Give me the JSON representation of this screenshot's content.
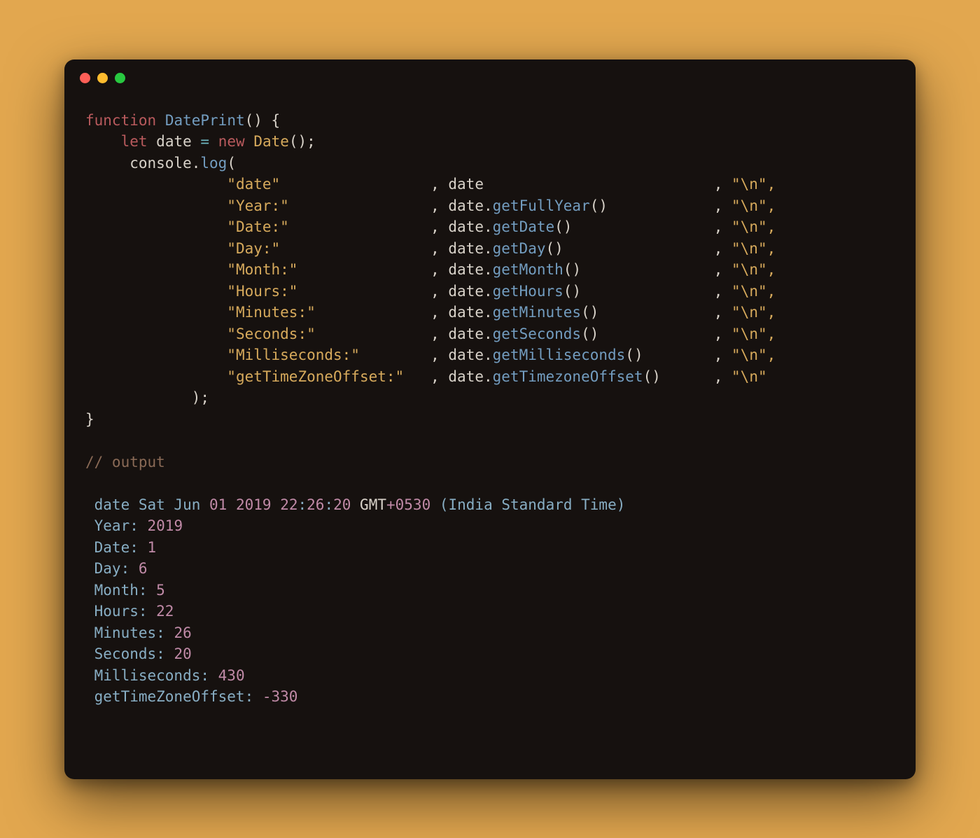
{
  "code": {
    "kw_function": "function",
    "fn_name": "DatePrint",
    "kw_let": "let",
    "var_date": "date",
    "op_eq": "=",
    "kw_new": "new",
    "cls_date": "Date",
    "obj_console": "console",
    "fn_log": "log",
    "rows": [
      {
        "label": "\"date\"",
        "expr_pre": "date",
        "expr_fn": "",
        "nl": "\"\\n\","
      },
      {
        "label": "\"Year:\"",
        "expr_pre": "date.",
        "expr_fn": "getFullYear",
        "nl": "\"\\n\","
      },
      {
        "label": "\"Date:\"",
        "expr_pre": "date.",
        "expr_fn": "getDate",
        "nl": "\"\\n\","
      },
      {
        "label": "\"Day:\"",
        "expr_pre": "date.",
        "expr_fn": "getDay",
        "nl": "\"\\n\","
      },
      {
        "label": "\"Month:\"",
        "expr_pre": "date.",
        "expr_fn": "getMonth",
        "nl": "\"\\n\","
      },
      {
        "label": "\"Hours:\"",
        "expr_pre": "date.",
        "expr_fn": "getHours",
        "nl": "\"\\n\","
      },
      {
        "label": "\"Minutes:\"",
        "expr_pre": "date.",
        "expr_fn": "getMinutes",
        "nl": "\"\\n\","
      },
      {
        "label": "\"Seconds:\"",
        "expr_pre": "date.",
        "expr_fn": "getSeconds",
        "nl": "\"\\n\","
      },
      {
        "label": "\"Milliseconds:\"",
        "expr_pre": "date.",
        "expr_fn": "getMilliseconds",
        "nl": "\"\\n\","
      },
      {
        "label": "\"getTimeZoneOffset:\"",
        "expr_pre": "date.",
        "expr_fn": "getTimezoneOffset",
        "nl": "\"\\n\""
      }
    ],
    "comment_out": "// output"
  },
  "output": {
    "line1": {
      "prefix": " date Sat Jun ",
      "d01": "01",
      "sp1": " ",
      "yr": "2019",
      "sp2": " ",
      "hh": "22",
      "c1": ":",
      "mm": "26",
      "c2": ":",
      "ss": "20",
      "gmt": " GMT",
      "plus": "+",
      "off": "0530",
      "tz": " (India Standard Time) "
    },
    "pairs": [
      {
        "k": " Year: ",
        "v": "2019"
      },
      {
        "k": " Date: ",
        "v": "1"
      },
      {
        "k": " Day: ",
        "v": "6"
      },
      {
        "k": " Month: ",
        "v": "5"
      },
      {
        "k": " Hours: ",
        "v": "22"
      },
      {
        "k": " Minutes: ",
        "v": "26"
      },
      {
        "k": " Seconds: ",
        "v": "20"
      },
      {
        "k": " Milliseconds: ",
        "v": "430"
      },
      {
        "k": " getTimeZoneOffset: ",
        "v": "-330"
      }
    ]
  }
}
